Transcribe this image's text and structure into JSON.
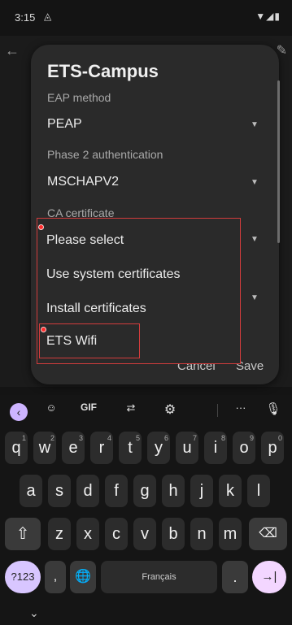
{
  "status": {
    "time": "3:15",
    "cast_icon": "cast-icon",
    "right_icons": "wifi signal battery"
  },
  "dialog": {
    "title": "ETS-Campus",
    "eap_method": {
      "label": "EAP method",
      "value": "PEAP"
    },
    "phase2": {
      "label": "Phase 2 authentication",
      "value": "MSCHAPV2"
    },
    "ca_certificate": {
      "label": "CA certificate"
    }
  },
  "dropdown": {
    "options": [
      "Please select",
      "Use system certificates",
      "Install certificates",
      "ETS Wifi"
    ]
  },
  "buttons": {
    "cancel": "Cancel",
    "save": "Save"
  },
  "keyboard": {
    "toolbar": {
      "gif": "GIF",
      "more": "···"
    },
    "row1": [
      {
        "k": "q",
        "n": "1"
      },
      {
        "k": "w",
        "n": "2"
      },
      {
        "k": "e",
        "n": "3"
      },
      {
        "k": "r",
        "n": "4"
      },
      {
        "k": "t",
        "n": "5"
      },
      {
        "k": "y",
        "n": "6"
      },
      {
        "k": "u",
        "n": "7"
      },
      {
        "k": "i",
        "n": "8"
      },
      {
        "k": "o",
        "n": "9"
      },
      {
        "k": "p",
        "n": "0"
      }
    ],
    "row2": [
      "a",
      "s",
      "d",
      "f",
      "g",
      "h",
      "j",
      "k",
      "l"
    ],
    "row3": [
      "z",
      "x",
      "c",
      "v",
      "b",
      "n",
      "m"
    ],
    "symbols_key": "?123",
    "comma_key": ",",
    "space_label": "Français",
    "period_key": ".",
    "enter_icon": "→|"
  },
  "colors": {
    "dialog_bg": "#2a2a2a",
    "highlight": "#d23c3c",
    "enter_key": "#f3d6ff"
  }
}
